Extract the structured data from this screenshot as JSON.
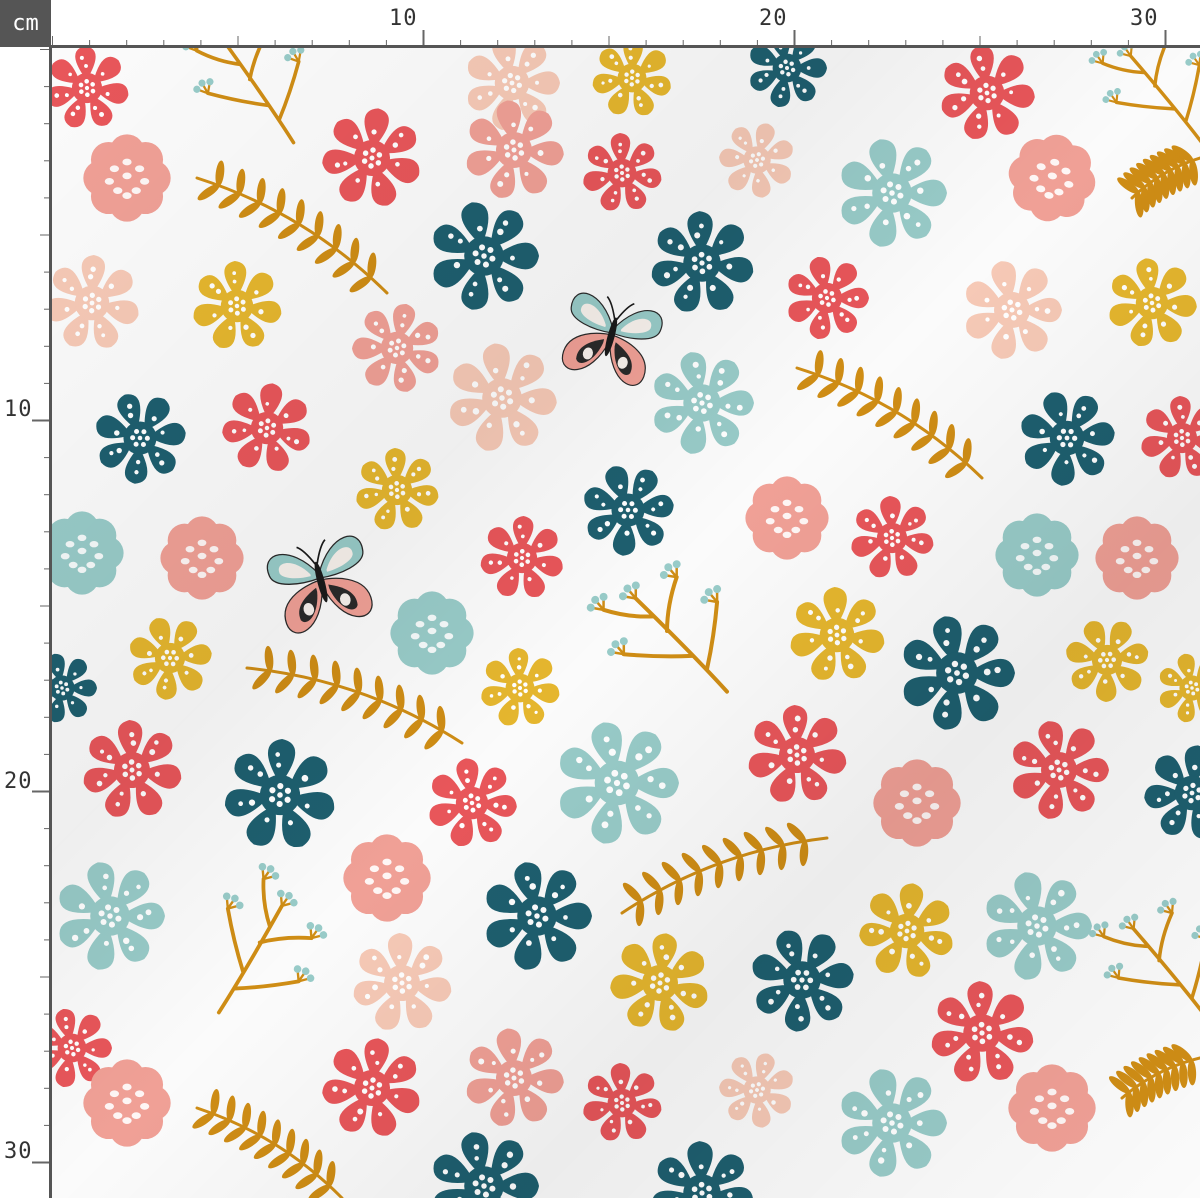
{
  "ruler": {
    "unit": "cm",
    "top_labels": [
      "10",
      "20",
      "30"
    ],
    "left_labels": [
      "10",
      "20",
      "30"
    ]
  },
  "colors": {
    "background": "#fbfbfb",
    "ruler_dark": "#555555",
    "coral": "#e8565a",
    "pink": "#f0a096",
    "peach": "#f6c9b6",
    "teal": "#1e5f6f",
    "mint": "#98cbc8",
    "mustard": "#e5b62e",
    "ochre": "#cf8d15"
  },
  "pattern": {
    "motifs": [
      "polka-dot-flower",
      "scalloped-flower",
      "leafy-branch",
      "berry-branch",
      "butterfly"
    ]
  }
}
